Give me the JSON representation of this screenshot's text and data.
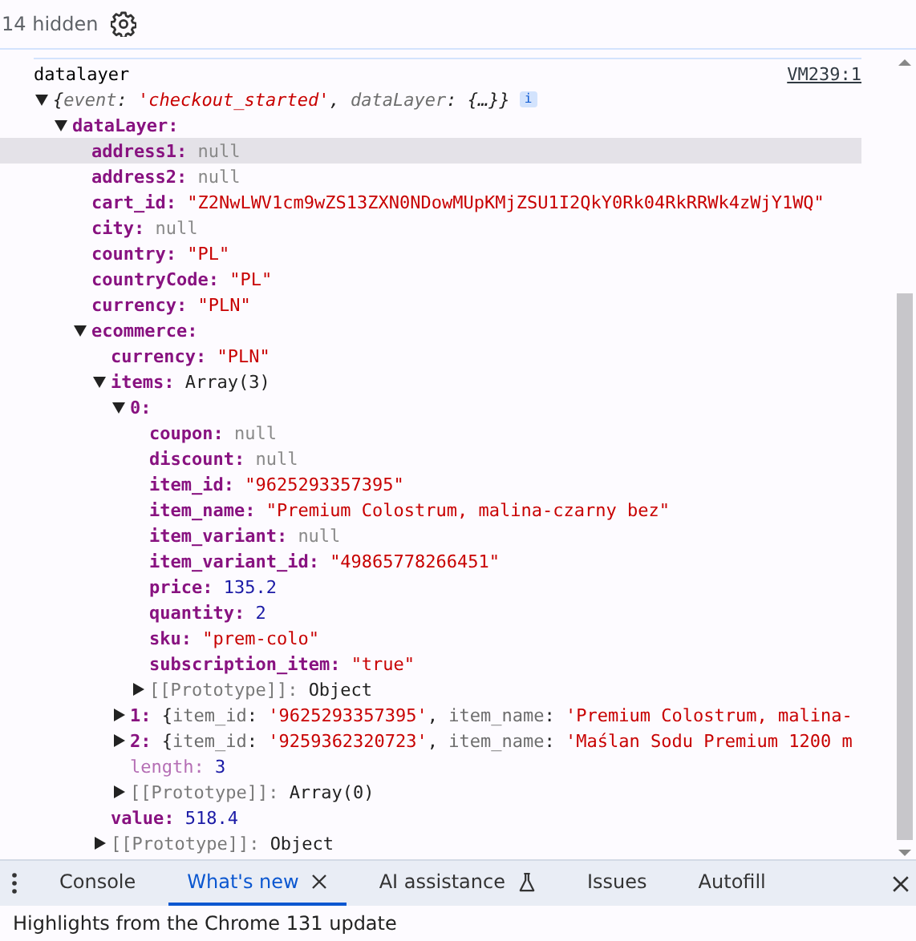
{
  "toolbar": {
    "hidden_count": "14 hidden"
  },
  "console": {
    "message": "datalayer",
    "source": "VM239:1",
    "tree": [
      {
        "kind": "summary",
        "expanded": true,
        "selected": false,
        "badge": "i",
        "segments": [
          {
            "t": "{",
            "kind": "plain"
          },
          {
            "t": "event",
            "kind": "pkey"
          },
          {
            "t": ": ",
            "kind": "plain"
          },
          {
            "t": "'checkout_started'",
            "kind": "str"
          },
          {
            "t": ", ",
            "kind": "plain"
          },
          {
            "t": "dataLayer",
            "kind": "pkey"
          },
          {
            "t": ": ",
            "kind": "plain"
          },
          {
            "t": "{…}}",
            "kind": "plain"
          }
        ],
        "children": [
          {
            "kind": "prop",
            "key": "dataLayer:",
            "expanded": true,
            "selected": false,
            "children": [
              {
                "kind": "prop",
                "key": "address1:",
                "selected": true,
                "segments": [
                  {
                    "t": "null",
                    "kind": "null"
                  }
                ]
              },
              {
                "kind": "prop",
                "key": "address2:",
                "selected": false,
                "segments": [
                  {
                    "t": "null",
                    "kind": "null"
                  }
                ]
              },
              {
                "kind": "prop",
                "key": "cart_id:",
                "selected": false,
                "segments": [
                  {
                    "t": "\"Z2NwLWV1cm9wZS13ZXN0NDowMUpKMjZSU1I2QkY0Rk04RkRRWk4zWjY1WQ\"",
                    "kind": "str"
                  }
                ]
              },
              {
                "kind": "prop",
                "key": "city:",
                "selected": false,
                "segments": [
                  {
                    "t": "null",
                    "kind": "null"
                  }
                ]
              },
              {
                "kind": "prop",
                "key": "country:",
                "selected": false,
                "segments": [
                  {
                    "t": "\"PL\"",
                    "kind": "str"
                  }
                ]
              },
              {
                "kind": "prop",
                "key": "countryCode:",
                "selected": false,
                "segments": [
                  {
                    "t": "\"PL\"",
                    "kind": "str"
                  }
                ]
              },
              {
                "kind": "prop",
                "key": "currency:",
                "selected": false,
                "segments": [
                  {
                    "t": "\"PLN\"",
                    "kind": "str"
                  }
                ]
              },
              {
                "kind": "prop",
                "key": "ecommerce:",
                "expanded": true,
                "selected": false,
                "children": [
                  {
                    "kind": "prop",
                    "key": "currency:",
                    "selected": false,
                    "segments": [
                      {
                        "t": "\"PLN\"",
                        "kind": "str"
                      }
                    ]
                  },
                  {
                    "kind": "prop",
                    "key": "items:",
                    "expanded": true,
                    "selected": false,
                    "segments": [
                      {
                        "t": "Array(3)",
                        "kind": "plain"
                      }
                    ],
                    "children": [
                      {
                        "kind": "prop",
                        "key": "0:",
                        "expanded": true,
                        "selected": false,
                        "children": [
                          {
                            "kind": "prop",
                            "key": "coupon:",
                            "selected": false,
                            "segments": [
                              {
                                "t": "null",
                                "kind": "null"
                              }
                            ]
                          },
                          {
                            "kind": "prop",
                            "key": "discount:",
                            "selected": false,
                            "segments": [
                              {
                                "t": "null",
                                "kind": "null"
                              }
                            ]
                          },
                          {
                            "kind": "prop",
                            "key": "item_id:",
                            "selected": false,
                            "segments": [
                              {
                                "t": "\"9625293357395\"",
                                "kind": "str"
                              }
                            ]
                          },
                          {
                            "kind": "prop",
                            "key": "item_name:",
                            "selected": false,
                            "segments": [
                              {
                                "t": "\"Premium Colostrum, malina-czarny bez\"",
                                "kind": "str"
                              }
                            ]
                          },
                          {
                            "kind": "prop",
                            "key": "item_variant:",
                            "selected": false,
                            "segments": [
                              {
                                "t": "null",
                                "kind": "null"
                              }
                            ]
                          },
                          {
                            "kind": "prop",
                            "key": "item_variant_id:",
                            "selected": false,
                            "segments": [
                              {
                                "t": "\"49865778266451\"",
                                "kind": "str"
                              }
                            ]
                          },
                          {
                            "kind": "prop",
                            "key": "price:",
                            "selected": false,
                            "segments": [
                              {
                                "t": "135.2",
                                "kind": "num"
                              }
                            ]
                          },
                          {
                            "kind": "prop",
                            "key": "quantity:",
                            "selected": false,
                            "segments": [
                              {
                                "t": "2",
                                "kind": "num"
                              }
                            ]
                          },
                          {
                            "kind": "prop",
                            "key": "sku:",
                            "selected": false,
                            "segments": [
                              {
                                "t": "\"prem-colo\"",
                                "kind": "str"
                              }
                            ]
                          },
                          {
                            "kind": "prop",
                            "key": "subscription_item:",
                            "selected": false,
                            "segments": [
                              {
                                "t": "\"true\"",
                                "kind": "str"
                              }
                            ]
                          },
                          {
                            "kind": "internal",
                            "key": "[[Prototype]]:",
                            "expanded": false,
                            "selected": false,
                            "segments": [
                              {
                                "t": "Object",
                                "kind": "plain"
                              }
                            ]
                          }
                        ]
                      },
                      {
                        "kind": "prop",
                        "key": "1:",
                        "expanded": false,
                        "selected": false,
                        "segments": [
                          {
                            "t": "{",
                            "kind": "plain"
                          },
                          {
                            "t": "item_id",
                            "kind": "pkey"
                          },
                          {
                            "t": ": ",
                            "kind": "plain"
                          },
                          {
                            "t": "'9625293357395'",
                            "kind": "str"
                          },
                          {
                            "t": ", ",
                            "kind": "plain"
                          },
                          {
                            "t": "item_name",
                            "kind": "pkey"
                          },
                          {
                            "t": ": ",
                            "kind": "plain"
                          },
                          {
                            "t": "'Premium Colostrum, malina-",
                            "kind": "str"
                          }
                        ]
                      },
                      {
                        "kind": "prop",
                        "key": "2:",
                        "expanded": false,
                        "selected": false,
                        "segments": [
                          {
                            "t": "{",
                            "kind": "plain"
                          },
                          {
                            "t": "item_id",
                            "kind": "pkey"
                          },
                          {
                            "t": ": ",
                            "kind": "plain"
                          },
                          {
                            "t": "'9259362320723'",
                            "kind": "str"
                          },
                          {
                            "t": ", ",
                            "kind": "plain"
                          },
                          {
                            "t": "item_name",
                            "kind": "pkey"
                          },
                          {
                            "t": ": ",
                            "kind": "plain"
                          },
                          {
                            "t": "'Maślan Sodu Premium 1200 m",
                            "kind": "str"
                          }
                        ]
                      },
                      {
                        "kind": "nonenum",
                        "key": "length:",
                        "selected": false,
                        "segments": [
                          {
                            "t": "3",
                            "kind": "num"
                          }
                        ]
                      },
                      {
                        "kind": "internal",
                        "key": "[[Prototype]]:",
                        "expanded": false,
                        "selected": false,
                        "segments": [
                          {
                            "t": "Array(0)",
                            "kind": "plain"
                          }
                        ]
                      }
                    ]
                  },
                  {
                    "kind": "prop",
                    "key": "value:",
                    "selected": false,
                    "segments": [
                      {
                        "t": "518.4",
                        "kind": "num"
                      }
                    ]
                  },
                  {
                    "kind": "internal",
                    "key": "[[Prototype]]:",
                    "expanded": false,
                    "selected": false,
                    "segments": [
                      {
                        "t": "Object",
                        "kind": "plain"
                      }
                    ]
                  }
                ]
              }
            ]
          }
        ]
      }
    ]
  },
  "drawer": {
    "tabs": [
      {
        "label": "Console",
        "kind": "plain",
        "selected": false,
        "closable": false
      },
      {
        "label": "What's new",
        "kind": "plain",
        "selected": true,
        "closable": true
      },
      {
        "label": "AI assistance",
        "kind": "experimental",
        "selected": false,
        "closable": false
      },
      {
        "label": "Issues",
        "kind": "plain",
        "selected": false,
        "closable": false
      },
      {
        "label": "Autofill",
        "kind": "plain",
        "selected": false,
        "closable": false
      }
    ],
    "content": "Highlights from the Chrome 131 update"
  }
}
